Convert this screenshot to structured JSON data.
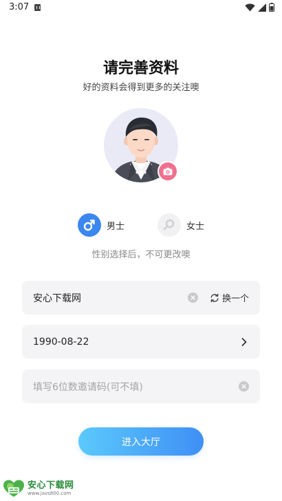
{
  "status_bar": {
    "time": "3:07"
  },
  "header": {
    "title": "请完善资料",
    "subtitle": "好的资料会得到更多的关注噢"
  },
  "gender": {
    "male_label": "男士",
    "female_label": "女士",
    "selected": "male",
    "hint": "性别选择后，不可更改噢"
  },
  "form": {
    "nickname_value": "安心下载网",
    "refresh_label": "换一个",
    "birthday_value": "1990-08-22",
    "invite_placeholder": "填写6位数邀请码(可不填)"
  },
  "actions": {
    "enter_label": "进入大厅"
  },
  "watermark": {
    "title": "安心下载网",
    "url": "www.javs800.com"
  },
  "colors": {
    "male_accent": "#3b87f0",
    "camera_badge": "#f1708f",
    "button_gradient_start": "#5bc9fb",
    "button_gradient_end": "#3f8ff5",
    "field_background": "#f4f4f6"
  },
  "icons": {
    "status": [
      "notification-icon",
      "wifi-icon",
      "signal-icon",
      "battery-icon"
    ],
    "avatar_badge": "camera-icon",
    "gender": [
      "male-symbol-icon",
      "female-search-icon"
    ],
    "field_actions": [
      "clear-icon",
      "refresh-icon",
      "chevron-right-icon"
    ]
  }
}
